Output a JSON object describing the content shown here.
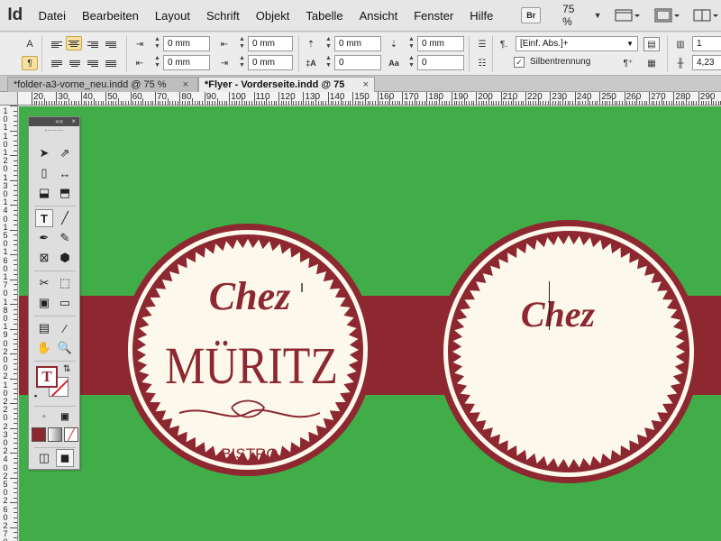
{
  "app": {
    "logo": "Id"
  },
  "menu": [
    "Datei",
    "Bearbeiten",
    "Layout",
    "Schrift",
    "Objekt",
    "Tabelle",
    "Ansicht",
    "Fenster",
    "Hilfe"
  ],
  "bridge_label": "Br",
  "zoom": "75 %",
  "control": {
    "indent_left": "0 mm",
    "indent_right": "0 mm",
    "space_before": "0 mm",
    "space_after": "0 mm",
    "first_line": "0 mm",
    "last_line": "0 mm",
    "dropcap_lines": "0",
    "dropcap_chars": "0",
    "paragraph_style": "[Einf. Abs.]+",
    "hyphenation_label": "Silbentrennung",
    "columns": "1",
    "gutter": "4,23"
  },
  "tabs": [
    {
      "label": "*folder-a3-vorne_neu.indd @ 75 %",
      "close": "×"
    },
    {
      "label": "*Flyer - Vorderseite.indd @ 75 %",
      "close": "×"
    }
  ],
  "ruler_labels": [
    "20",
    "30",
    "40",
    "50",
    "60",
    "70",
    "80",
    "90",
    "100",
    "110",
    "120",
    "130",
    "140",
    "150",
    "160",
    "170",
    "180",
    "190",
    "200",
    "210",
    "220",
    "230",
    "240",
    "250",
    "260",
    "270",
    "280",
    "290"
  ],
  "vruler_labels": [
    "1",
    "0",
    "1",
    "1",
    "0",
    "1",
    "2",
    "0",
    "1",
    "3",
    "0",
    "1",
    "4",
    "0",
    "1",
    "5",
    "0",
    "1",
    "6",
    "0",
    "1",
    "7",
    "0",
    "1",
    "8",
    "0",
    "1",
    "9",
    "0",
    "2",
    "0",
    "0",
    "2",
    "1",
    "0",
    "2",
    "2",
    "0",
    "2",
    "3",
    "0",
    "2",
    "4",
    "0",
    "2",
    "5",
    "0",
    "2",
    "6",
    "0",
    "2",
    "7",
    "0"
  ],
  "badge_left": {
    "chez": "Chez",
    "name": "MÜRITZ",
    "sub": "BISTRO"
  },
  "badge_right": {
    "chez": "Chez"
  },
  "tools_panel": {
    "collapse": "««",
    "close": "×"
  },
  "colors": {
    "green": "#41ad49",
    "red": "#8d2830",
    "cream": "#fcf9ec"
  }
}
